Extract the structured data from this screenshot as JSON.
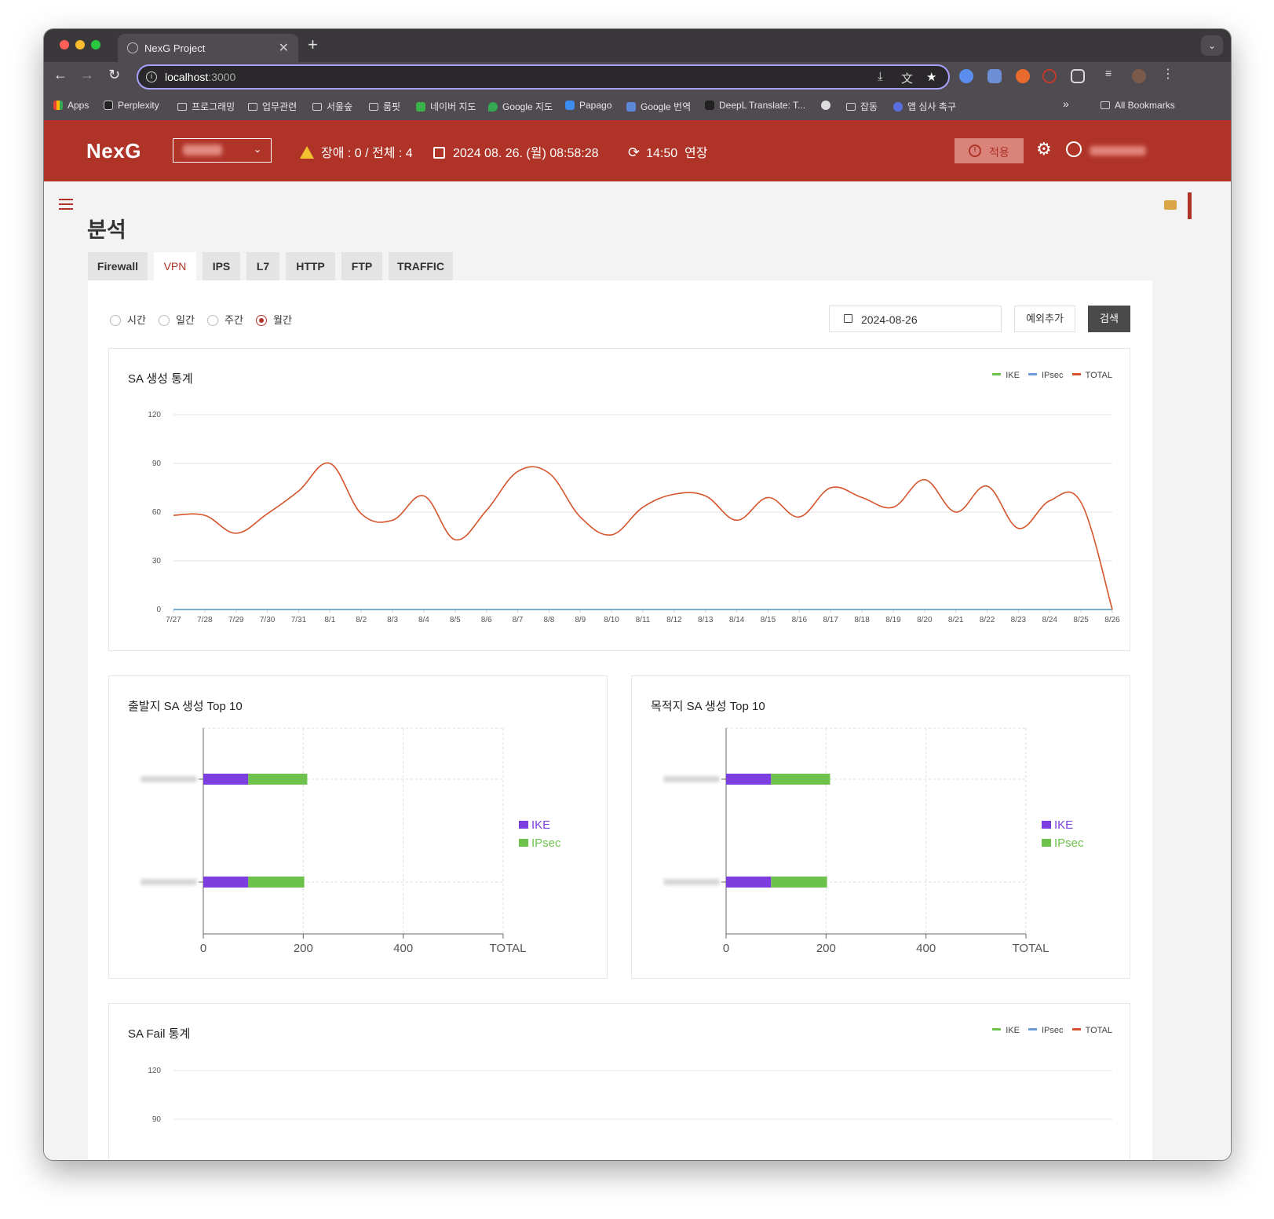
{
  "browser": {
    "tab_title": "NexG Project",
    "tab_close": "✕",
    "new_tab": "+",
    "url_host": "localhost",
    "url_port": ":3000",
    "bookmarks": [
      "Apps",
      "Perplexity",
      "프로그래밍",
      "업무관련",
      "서울숲",
      "룸핏",
      "네이버 지도",
      "Google 지도",
      "Papago",
      "Google 번역",
      "DeepL Translate: T...",
      "잡동",
      "앱 심사 촉구"
    ],
    "bookmarks_overflow": "»",
    "all_bookmarks": "All Bookmarks"
  },
  "header": {
    "logo": "NexG",
    "status": "장애 : 0 / 전체 : 4",
    "datetime": "2024 08. 26. (월) 08:58:28",
    "timer": "14:50  연장",
    "apply_label": "적용",
    "apply_icon": "!",
    "timer_icon": "⟳",
    "gear_icon": "⚙"
  },
  "page": {
    "title": "분석",
    "tabs": [
      "Firewall",
      "VPN",
      "IPS",
      "L7",
      "HTTP",
      "FTP",
      "TRAFFIC"
    ],
    "active_tab": "VPN"
  },
  "filters": {
    "periods": [
      "시간",
      "일간",
      "주간",
      "월간"
    ],
    "selected_period": "월간",
    "date": "2024-08-26",
    "exception_button": "예외추가",
    "search_button": "검색"
  },
  "legend": {
    "ike": "IKE",
    "ipsec": "IPsec",
    "total": "TOTAL"
  },
  "colors": {
    "accent": "#b03328",
    "ike_line": "#6cc24a",
    "ipsec_line": "#6b9bd8",
    "total_line": "#d5542b",
    "ike_bar": "#7d3ee0",
    "ipsec_bar": "#6cc24a"
  },
  "chart_data": [
    {
      "id": "sa_creation",
      "type": "line",
      "title": "SA 생성 통계",
      "x": [
        "7/27",
        "7/28",
        "7/29",
        "7/30",
        "7/31",
        "8/1",
        "8/2",
        "8/3",
        "8/4",
        "8/5",
        "8/6",
        "8/7",
        "8/8",
        "8/9",
        "8/10",
        "8/11",
        "8/12",
        "8/13",
        "8/14",
        "8/15",
        "8/16",
        "8/17",
        "8/18",
        "8/19",
        "8/20",
        "8/21",
        "8/22",
        "8/23",
        "8/24",
        "8/25",
        "8/26"
      ],
      "ylim": [
        0,
        120
      ],
      "yticks": [
        0,
        30,
        60,
        90,
        120
      ],
      "series": [
        {
          "name": "IKE",
          "values": [
            0,
            0,
            0,
            0,
            0,
            0,
            0,
            0,
            0,
            0,
            0,
            0,
            0,
            0,
            0,
            0,
            0,
            0,
            0,
            0,
            0,
            0,
            0,
            0,
            0,
            0,
            0,
            0,
            0,
            0,
            0
          ]
        },
        {
          "name": "IPsec",
          "values": [
            0,
            0,
            0,
            0,
            0,
            0,
            0,
            0,
            0,
            0,
            0,
            0,
            0,
            0,
            0,
            0,
            0,
            0,
            0,
            0,
            0,
            0,
            0,
            0,
            0,
            0,
            0,
            0,
            0,
            0,
            0
          ]
        },
        {
          "name": "TOTAL",
          "values": [
            58,
            58,
            47,
            59,
            73,
            90,
            59,
            55,
            70,
            43,
            61,
            85,
            84,
            57,
            46,
            63,
            71,
            70,
            55,
            69,
            57,
            75,
            69,
            63,
            80,
            60,
            76,
            50,
            67,
            66,
            0
          ]
        }
      ],
      "grid": true,
      "legend_position": "top-right"
    },
    {
      "id": "src_top10",
      "type": "bar",
      "orientation": "horizontal",
      "stacked": true,
      "title": "출발지 SA 생성 Top 10",
      "xticks": [
        "0",
        "200",
        "400",
        "TOTAL"
      ],
      "xlim": [
        0,
        600
      ],
      "categories": [
        "",
        ""
      ],
      "series": [
        {
          "name": "IKE",
          "values": [
            90,
            90
          ]
        },
        {
          "name": "IPsec",
          "values": [
            118,
            112
          ]
        }
      ],
      "legend_position": "right"
    },
    {
      "id": "dst_top10",
      "type": "bar",
      "orientation": "horizontal",
      "stacked": true,
      "title": "목적지 SA 생성 Top 10",
      "xticks": [
        "0",
        "200",
        "400",
        "TOTAL"
      ],
      "xlim": [
        0,
        600
      ],
      "categories": [
        "",
        ""
      ],
      "series": [
        {
          "name": "IKE",
          "values": [
            90,
            90
          ]
        },
        {
          "name": "IPsec",
          "values": [
            118,
            112
          ]
        }
      ],
      "legend_position": "right"
    },
    {
      "id": "sa_fail",
      "type": "line",
      "title": "SA Fail 통계",
      "yticks": [
        90,
        120
      ],
      "ylim": [
        0,
        120
      ],
      "grid": true,
      "legend_position": "top-right"
    }
  ]
}
